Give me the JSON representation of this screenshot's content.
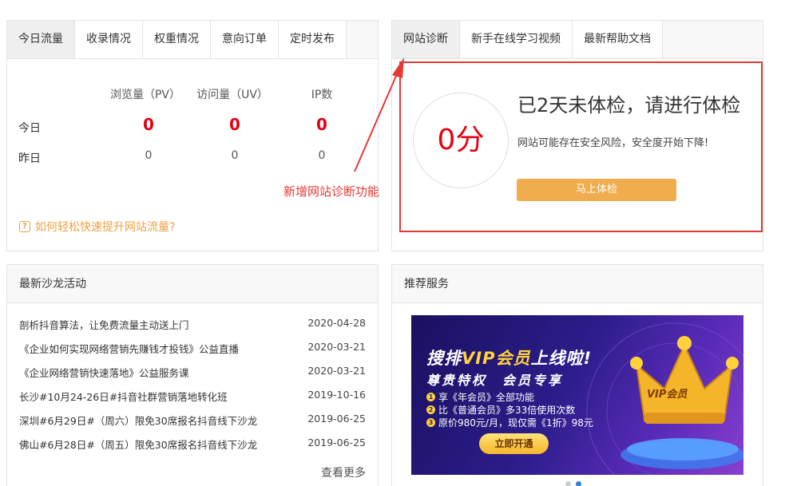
{
  "traffic": {
    "tabs": [
      "今日流量",
      "收录情况",
      "权重情况",
      "意向订单",
      "定时发布"
    ],
    "columns": [
      "浏览量（PV）",
      "访问量（UV）",
      "IP数"
    ],
    "rows": [
      {
        "label": "今日",
        "values": [
          "0",
          "0",
          "0"
        ]
      },
      {
        "label": "昨日",
        "values": [
          "0",
          "0",
          "0"
        ]
      }
    ],
    "help_icon": "?",
    "help_link": "如何轻松快速提升网站流量?"
  },
  "diagnosis": {
    "tabs": [
      "网站诊断",
      "新手在线学习视频",
      "最新帮助文档"
    ],
    "score": "0分",
    "title": "已2天未体检，请进行体检",
    "desc": "网站可能存在安全风险，安全度开始下降!",
    "button": "马上体检"
  },
  "annotation": "新增网站诊断功能",
  "salon": {
    "title": "最新沙龙活动",
    "items": [
      {
        "title": "剖析抖音算法，让免费流量主动送上门",
        "date": "2020-04-28"
      },
      {
        "title": "《企业如何实现网络营销先赚钱才投钱》公益直播",
        "date": "2020-03-21"
      },
      {
        "title": "《企业网络营销快速落地》公益服务课",
        "date": "2020-03-21"
      },
      {
        "title": "长沙#10月24-26日#抖音社群营销落地转化班",
        "date": "2019-10-16"
      },
      {
        "title": "深圳#6月29日#（周六）限免30席报名抖音线下沙龙",
        "date": "2019-06-25"
      },
      {
        "title": "佛山#6月28日#（周五）限免30席报名抖音线下沙龙",
        "date": "2019-06-25"
      }
    ],
    "more": "查看更多"
  },
  "services": {
    "title": "推荐服务",
    "banner": {
      "head_pre": "搜排",
      "head_vip": "VIP会员",
      "head_post": "上线啦!",
      "sub": "尊贵特权　会员专享",
      "lines": [
        "享《年会员》全部功能",
        "比《普通会员》多33倍使用次数",
        "原价980元/月，现仅需《1折》98元"
      ],
      "bullets": [
        "1",
        "2",
        "3"
      ],
      "crown_text": "VIP会员",
      "button": "立即开通"
    }
  },
  "colors": {
    "accent_red": "#e60012",
    "orange": "#f0ad4e",
    "annotation": "#e53935"
  }
}
